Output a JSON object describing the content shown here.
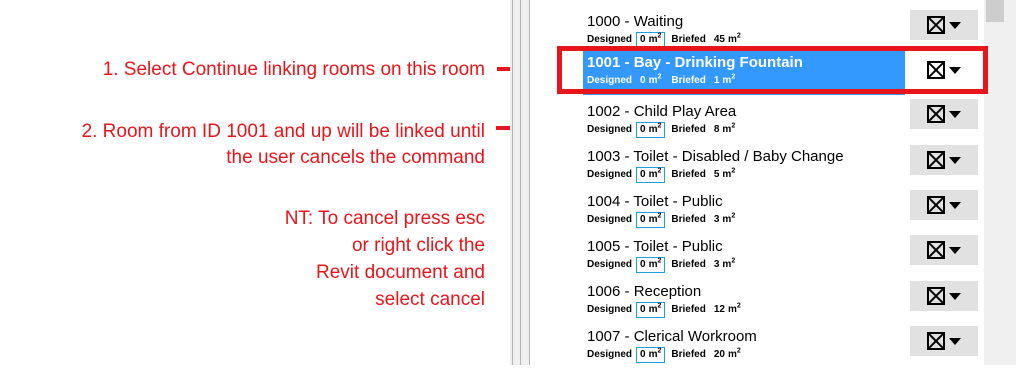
{
  "annotations": {
    "step1": "1. Select Continue linking rooms on this room",
    "step2_line1": "2. Room from ID 1001 and up will be linked until",
    "step2_line2": "the user cancels the command",
    "note_line1": "NT: To cancel press esc",
    "note_line2": "or right click the",
    "note_line3": "Revit document and",
    "note_line4": "select cancel"
  },
  "colors": {
    "annotation_red": "#e8161b",
    "selection_blue": "#3399ff",
    "value_box_border": "#1ea0e0"
  },
  "room_list": {
    "designed_label": "Designed",
    "briefed_label": "Briefed",
    "unit": "m",
    "rooms": [
      {
        "title": "1000  -  Waiting",
        "designed": "0",
        "briefed": "45",
        "checkbox_icon": "x-box-icon",
        "selected": false
      },
      {
        "title": "1001  -  Bay - Drinking Fountain",
        "designed": "0",
        "briefed": "1",
        "checkbox_icon": "x-box-icon",
        "selected": true
      },
      {
        "title": "1002  -  Child Play Area",
        "designed": "0",
        "briefed": "8",
        "checkbox_icon": "x-box-icon",
        "selected": false
      },
      {
        "title": "1003  -  Toilet - Disabled / Baby Change",
        "designed": "0",
        "briefed": "5",
        "checkbox_icon": "x-box-icon",
        "selected": false
      },
      {
        "title": "1004  -  Toilet - Public",
        "designed": "0",
        "briefed": "3",
        "checkbox_icon": "x-box-icon",
        "selected": false
      },
      {
        "title": "1005  -  Toilet - Public",
        "designed": "0",
        "briefed": "3",
        "checkbox_icon": "x-box-icon",
        "selected": false
      },
      {
        "title": "1006  -  Reception",
        "designed": "0",
        "briefed": "12",
        "checkbox_icon": "x-box-icon",
        "selected": false
      },
      {
        "title": "1007  -  Clerical Workroom",
        "designed": "0",
        "briefed": "20",
        "checkbox_icon": "x-box-icon",
        "selected": false
      }
    ]
  }
}
